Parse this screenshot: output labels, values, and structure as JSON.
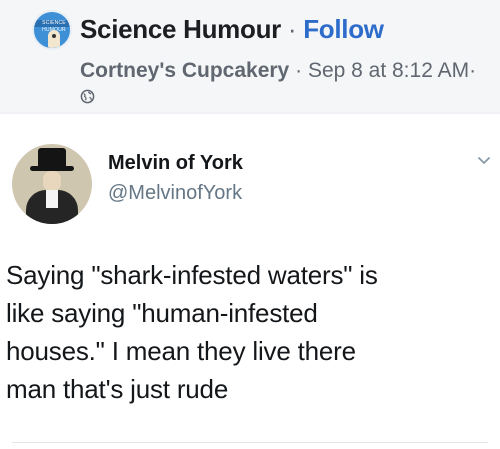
{
  "post_header": {
    "page_name": "Science Humour",
    "separator": "·",
    "follow_label": "Follow",
    "author": "Cortney's Cupcakery",
    "meta_separator": "·",
    "date": "Sep 8 at 8:12",
    "time_suffix": "AM",
    "time_separator": "·",
    "privacy_icon": "globe-icon",
    "avatar_badge_text": "SCIENCE HUMOUR"
  },
  "tweet": {
    "display_name": "Melvin of York",
    "handle": "@MelvinofYork",
    "menu_icon": "chevron-down-icon",
    "lines": [
      "Saying \"shark-infested waters\" is",
      "like saying \"human-infested",
      "houses.\" I mean they live there",
      "man that's just rude"
    ]
  },
  "colors": {
    "link_blue": "#2d6ccb",
    "meta_gray": "#606770",
    "handle_gray": "#657786",
    "text_dark": "#14171a"
  }
}
